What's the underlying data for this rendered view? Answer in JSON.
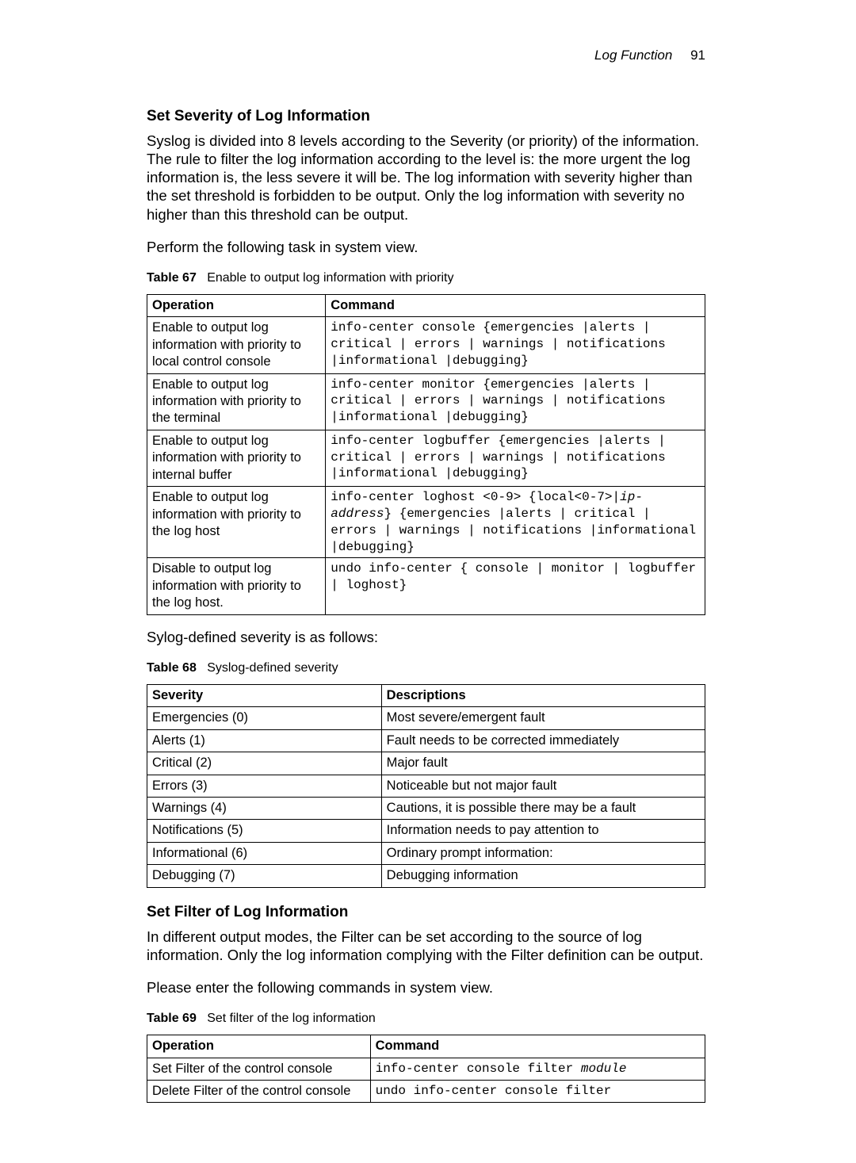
{
  "header": {
    "title": "Log Function",
    "page_number": "91"
  },
  "section1": {
    "heading": "Set Severity of Log Information",
    "para1": "Syslog is divided into 8 levels according to the Severity (or priority) of the information. The rule to filter the log information according to the level is: the more urgent the log information is, the less severe it will be. The log information with severity higher than the set threshold is forbidden to be output. Only the log information with severity no higher than this threshold can be output.",
    "para2": "Perform the following task in system view.",
    "table_caption_label": "Table 67",
    "table_caption_text": "Enable to output log information with priority",
    "table_headers": {
      "col1": "Operation",
      "col2": "Command"
    },
    "rows": [
      {
        "op": "Enable to output log information with priority to local control console",
        "cmd": "info-center console {emergencies |alerts | critical | errors | warnings | notifications |informational |debugging}"
      },
      {
        "op": "Enable to output log information with priority to the terminal",
        "cmd": "info-center monitor {emergencies |alerts | critical | errors | warnings | notifications |informational |debugging}"
      },
      {
        "op": "Enable to output log information with priority to internal buffer",
        "cmd": "info-center logbuffer {emergencies |alerts | critical | errors | warnings | notifications |informational |debugging}"
      },
      {
        "op": "Enable to output log information with priority to the log host",
        "cmd_pre": "info-center loghost <0-9> {local<0-7>|",
        "cmd_arg": "ip-address",
        "cmd_post": "} {emergencies |alerts | critical | errors | warnings | notifications |informational |debugging}"
      },
      {
        "op": "Disable to output log information with priority to the log host.",
        "cmd": "undo info-center { console | monitor | logbuffer | loghost}"
      }
    ],
    "after_table": "Sylog-defined severity is as follows:"
  },
  "section2": {
    "table_caption_label": "Table 68",
    "table_caption_text": "Syslog-defined severity",
    "table_headers": {
      "col1": "Severity",
      "col2": "Descriptions"
    },
    "rows": [
      {
        "sev": "Emergencies (0)",
        "desc": "Most severe/emergent fault"
      },
      {
        "sev": "Alerts (1)",
        "desc": "Fault needs to be corrected immediately"
      },
      {
        "sev": "Critical (2)",
        "desc": "Major fault"
      },
      {
        "sev": "Errors (3)",
        "desc": "Noticeable but not major fault"
      },
      {
        "sev": "Warnings (4)",
        "desc": "Cautions, it is possible there may be a fault"
      },
      {
        "sev": "Notifications (5)",
        "desc": "Information needs to pay attention to"
      },
      {
        "sev": "Informational (6)",
        "desc": "Ordinary prompt information:"
      },
      {
        "sev": "Debugging (7)",
        "desc": "Debugging information"
      }
    ]
  },
  "section3": {
    "heading": "Set Filter of Log Information",
    "para1": "In different output modes, the Filter can be set according to the source of log information. Only the log information complying with the Filter definition can be output.",
    "para2": "Please enter the following commands in system view.",
    "table_caption_label": "Table 69",
    "table_caption_text": "Set filter of the log information",
    "table_headers": {
      "col1": "Operation",
      "col2": "Command"
    },
    "rows": [
      {
        "op": "Set Filter of the control console",
        "cmd_pre": "info-center console filter ",
        "cmd_arg": "module",
        "cmd_post": ""
      },
      {
        "op": "Delete Filter of the control console",
        "cmd": "undo info-center console filter"
      }
    ]
  }
}
